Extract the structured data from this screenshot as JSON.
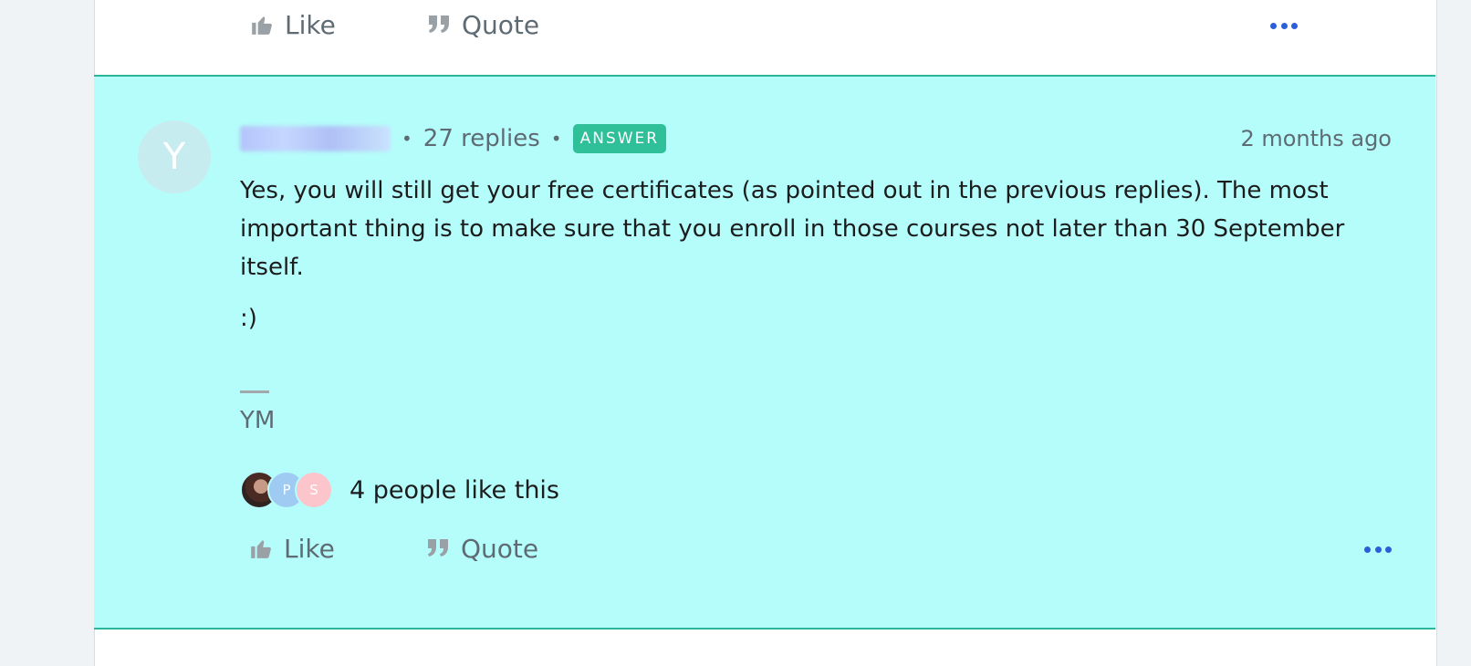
{
  "prev_post": {
    "like_label": "Like",
    "quote_label": "Quote"
  },
  "answer": {
    "avatar_letter": "Y",
    "replies": "27 replies",
    "badge": "ANSWER",
    "time": "2 months ago",
    "paragraphs": [
      "Yes, you will still get your free certificates (as pointed out in the previous replies). The most important thing is to make sure that you enroll in those courses not later than 30 September itself.",
      ":)"
    ],
    "signature": "YM",
    "likers": {
      "avatars": [
        "P",
        "S"
      ],
      "text": "4 people like this"
    },
    "like_label": "Like",
    "quote_label": "Quote"
  },
  "colors": {
    "highlight": "#b5fdfb",
    "answer_badge": "#2fbf99",
    "accent": "#2b5fd9"
  }
}
